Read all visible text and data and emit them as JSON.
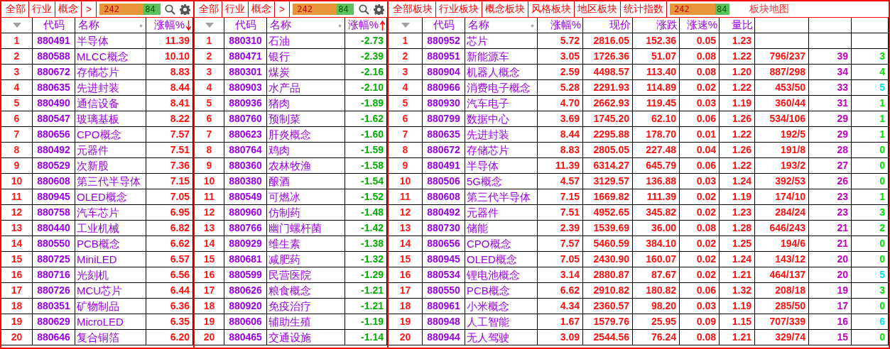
{
  "panels": [
    {
      "kind": "ranking",
      "tabs": [
        {
          "label": "全部",
          "selected": false
        },
        {
          "label": "行业",
          "selected": false
        },
        {
          "label": "概念",
          "selected": false
        }
      ],
      "more": ">",
      "counter": {
        "up": "242",
        "down": "84"
      },
      "columns": [
        {
          "kind": "rank"
        },
        {
          "kind": "code",
          "label": "代码"
        },
        {
          "kind": "name",
          "label": "名称"
        },
        {
          "kind": "gain",
          "label": "涨幅%",
          "sort_descending": true
        }
      ],
      "rows": [
        [
          "1",
          "880491",
          "半导体",
          "11.39"
        ],
        [
          "2",
          "880588",
          "MLCC概念",
          "10.10"
        ],
        [
          "3",
          "880672",
          "存储芯片",
          "8.83"
        ],
        [
          "4",
          "880635",
          "先进封装",
          "8.44"
        ],
        [
          "5",
          "880490",
          "通信设备",
          "8.41"
        ],
        [
          "6",
          "880547",
          "玻璃基板",
          "8.22"
        ],
        [
          "7",
          "880656",
          "CPO概念",
          "7.57"
        ],
        [
          "8",
          "880492",
          "元器件",
          "7.51"
        ],
        [
          "9",
          "880529",
          "次新股",
          "7.36"
        ],
        [
          "10",
          "880608",
          "第三代半导体",
          "7.15"
        ],
        [
          "11",
          "880945",
          "OLED概念",
          "7.05"
        ],
        [
          "12",
          "880758",
          "汽车芯片",
          "6.95"
        ],
        [
          "13",
          "880440",
          "工业机械",
          "6.82"
        ],
        [
          "14",
          "880550",
          "PCB概念",
          "6.62"
        ],
        [
          "15",
          "880725",
          "MiniLED",
          "6.57"
        ],
        [
          "16",
          "880716",
          "光刻机",
          "6.56"
        ],
        [
          "17",
          "880726",
          "MCU芯片",
          "6.44"
        ],
        [
          "18",
          "880351",
          "矿物制品",
          "6.36"
        ],
        [
          "19",
          "880629",
          "MicroLED",
          "6.35"
        ],
        [
          "20",
          "880646",
          "复合铜箔",
          "6.20"
        ]
      ]
    },
    {
      "kind": "ranking",
      "tabs": [
        {
          "label": "全部",
          "selected": false
        },
        {
          "label": "行业",
          "selected": false
        },
        {
          "label": "概念",
          "selected": false
        }
      ],
      "more": ">",
      "counter": {
        "up": "242",
        "down": "84"
      },
      "columns": [
        {
          "kind": "rank"
        },
        {
          "kind": "code",
          "label": "代码"
        },
        {
          "kind": "name",
          "label": "名称"
        },
        {
          "kind": "loss",
          "label": "涨幅%",
          "sort_descending": false
        }
      ],
      "rows": [
        [
          "1",
          "880310",
          "石油",
          "-2.73"
        ],
        [
          "2",
          "880471",
          "银行",
          "-2.39"
        ],
        [
          "3",
          "880301",
          "煤炭",
          "-2.16"
        ],
        [
          "4",
          "880903",
          "水产品",
          "-2.10"
        ],
        [
          "5",
          "880936",
          "猪肉",
          "-1.89"
        ],
        [
          "6",
          "880760",
          "预制菜",
          "-1.62"
        ],
        [
          "7",
          "880623",
          "肝炎概念",
          "-1.60"
        ],
        [
          "8",
          "880764",
          "鸡肉",
          "-1.59"
        ],
        [
          "9",
          "880360",
          "农林牧渔",
          "-1.58"
        ],
        [
          "10",
          "880380",
          "酿酒",
          "-1.54"
        ],
        [
          "11",
          "880549",
          "可燃冰",
          "-1.52"
        ],
        [
          "12",
          "880960",
          "仿制药",
          "-1.48"
        ],
        [
          "13",
          "880766",
          "幽门螺杆菌",
          "-1.42"
        ],
        [
          "14",
          "880929",
          "维生素",
          "-1.38"
        ],
        [
          "15",
          "880681",
          "减肥药",
          "-1.32"
        ],
        [
          "16",
          "880599",
          "民营医院",
          "-1.29"
        ],
        [
          "17",
          "880626",
          "粮食概念",
          "-1.21"
        ],
        [
          "18",
          "880920",
          "免疫治疗",
          "-1.21"
        ],
        [
          "19",
          "880606",
          "辅助生殖",
          "-1.19"
        ],
        [
          "20",
          "880465",
          "交通设施",
          "-1.14"
        ]
      ]
    },
    {
      "kind": "board",
      "tabs": [
        {
          "label": "全部板块",
          "selected": false
        },
        {
          "label": "行业板块",
          "selected": false
        },
        {
          "label": "概念板块",
          "selected": false
        },
        {
          "label": "风格板块",
          "selected": false
        },
        {
          "label": "地区板块",
          "selected": false
        },
        {
          "label": "统计指数",
          "selected": false
        }
      ],
      "counter": {
        "up": "242",
        "down": "84"
      },
      "link": "板块地图",
      "columns": [
        {
          "kind": "rank"
        },
        {
          "kind": "code",
          "label": "代码"
        },
        {
          "kind": "name",
          "label": "名称"
        },
        {
          "kind": "gain",
          "label": "涨幅%"
        },
        {
          "kind": "value",
          "label": "现价"
        },
        {
          "kind": "value",
          "label": "涨跌"
        },
        {
          "kind": "value",
          "label": "涨速%"
        },
        {
          "kind": "value",
          "label": "量比"
        },
        {
          "kind": "value"
        },
        {
          "kind": "count"
        },
        {
          "kind": "flag"
        }
      ],
      "rows": [
        [
          "1",
          "880952",
          "芯片",
          "5.72",
          "2816.05",
          "152.36",
          "0.05",
          "1.23"
        ],
        [
          "2",
          "880951",
          "新能源车",
          "3.05",
          "1726.36",
          "51.07",
          "0.08",
          "1.22",
          "796/237",
          "39",
          {
            "text": "3",
            "color": "#00e000"
          }
        ],
        [
          "3",
          "880904",
          "机器人概念",
          "2.59",
          "4498.57",
          "113.40",
          "0.08",
          "1.20",
          "887/298",
          "34",
          {
            "text": "4",
            "color": "#00e000"
          }
        ],
        [
          "4",
          "880966",
          "消费电子概念",
          "5.28",
          "2291.93",
          "114.89",
          "0.02",
          "1.22",
          "453/50",
          "33",
          {
            "text": "5",
            "color": "#00e0f0"
          }
        ],
        [
          "5",
          "880930",
          "汽车电子",
          "4.70",
          "2662.93",
          "119.45",
          "0.03",
          "1.19",
          "360/44",
          "31",
          {
            "text": "1",
            "color": "#00e000"
          }
        ],
        [
          "6",
          "880799",
          "数据中心",
          "3.69",
          "1745.20",
          "62.10",
          "0.06",
          "1.26",
          "534/106",
          "29",
          {
            "text": "1",
            "color": "#00e000"
          }
        ],
        [
          "7",
          "880635",
          "先进封装",
          "8.44",
          "2295.88",
          "178.70",
          "0.01",
          "1.22",
          "192/5",
          "29",
          {
            "text": "1",
            "color": "#00e000"
          }
        ],
        [
          "8",
          "880672",
          "存储芯片",
          "8.83",
          "2805.05",
          "227.48",
          "0.04",
          "1.26",
          "191/8",
          "28",
          {
            "text": "0",
            "color": "#00e000"
          }
        ],
        [
          "9",
          "880491",
          "半导体",
          "11.39",
          "6314.27",
          "645.79",
          "0.06",
          "1.22",
          "193/2",
          "27",
          {
            "text": "0",
            "color": "#00e000"
          }
        ],
        [
          "10",
          "880506",
          "5G概念",
          "4.57",
          "3129.57",
          "136.88",
          "0.03",
          "1.24",
          "392/53",
          "26",
          {
            "text": "0",
            "color": "#00e000"
          }
        ],
        [
          "11",
          "880608",
          "第三代半导体",
          "7.15",
          "1669.82",
          "111.39",
          "0.02",
          "1.19",
          "174/10",
          "23",
          {
            "text": "1",
            "color": "#00e000"
          }
        ],
        [
          "12",
          "880492",
          "元器件",
          "7.51",
          "4952.65",
          "345.82",
          "0.02",
          "1.23",
          "284/24",
          "23",
          {
            "text": "3",
            "color": "#00e000"
          }
        ],
        [
          "13",
          "880730",
          "储能",
          "2.39",
          "1539.69",
          "36.00",
          "0.08",
          "1.28",
          "646/243",
          "21",
          {
            "text": "2",
            "color": "#00e000"
          }
        ],
        [
          "14",
          "880656",
          "CPO概念",
          "7.57",
          "5460.59",
          "384.10",
          "0.02",
          "1.25",
          "194/6",
          "21",
          {
            "text": "0",
            "color": "#00e000"
          }
        ],
        [
          "15",
          "880945",
          "OLED概念",
          "7.05",
          "2430.90",
          "160.07",
          "0.02",
          "1.24",
          "143/12",
          "20",
          {
            "text": "0",
            "color": "#00e000"
          }
        ],
        [
          "16",
          "880534",
          "锂电池概念",
          "3.14",
          "2880.87",
          "87.67",
          "0.02",
          "1.21",
          "464/137",
          "20",
          {
            "text": "5",
            "color": "#00e0f0"
          }
        ],
        [
          "17",
          "880550",
          "PCB概念",
          "6.62",
          "2910.82",
          "180.82",
          "0.06",
          "1.32",
          "208/18",
          "19",
          {
            "text": "3",
            "color": "#00e000"
          }
        ],
        [
          "18",
          "880961",
          "小米概念",
          "4.34",
          "2360.57",
          "98.20",
          "0.03",
          "1.19",
          "285/50",
          "17",
          {
            "text": "0",
            "color": "#00e000"
          }
        ],
        [
          "19",
          "880948",
          "人工智能",
          "1.67",
          "1579.76",
          "25.95",
          "0.09",
          "1.15",
          "707/339",
          "16",
          {
            "text": "6",
            "color": "#00e0f0"
          }
        ],
        [
          "20",
          "880944",
          "无人驾驶",
          "3.09",
          "2544.56",
          "76.24",
          "0.08",
          "1.21",
          "329/74",
          "15",
          {
            "text": "0",
            "color": "#00e000"
          }
        ]
      ]
    }
  ]
}
